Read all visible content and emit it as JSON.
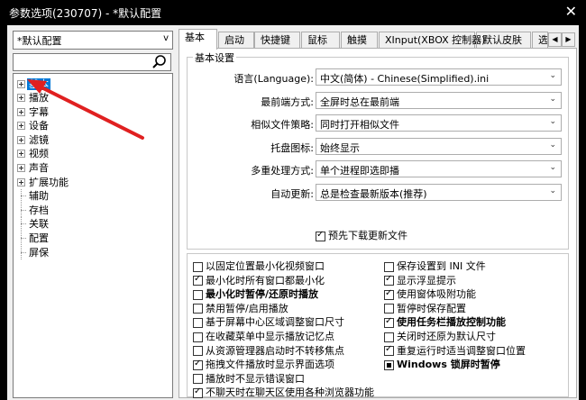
{
  "window": {
    "title": "参数选项(230707) - *默认配置",
    "close_label": "✕"
  },
  "sidebar": {
    "preset": "*默认配置",
    "search_value": "",
    "tree": [
      {
        "label": "基本",
        "expandable": true,
        "selected": true
      },
      {
        "label": "播放",
        "expandable": true
      },
      {
        "label": "字幕",
        "expandable": true
      },
      {
        "label": "设备",
        "expandable": true
      },
      {
        "label": "滤镜",
        "expandable": true
      },
      {
        "label": "视频",
        "expandable": true
      },
      {
        "label": "声音",
        "expandable": true
      },
      {
        "label": "扩展功能",
        "expandable": true
      },
      {
        "label": "辅助",
        "expandable": false
      },
      {
        "label": "存档",
        "expandable": false
      },
      {
        "label": "关联",
        "expandable": false
      },
      {
        "label": "配置",
        "expandable": false
      },
      {
        "label": "屏保",
        "expandable": false
      }
    ]
  },
  "tabs": [
    "基本",
    "启动",
    "快捷键",
    "鼠标",
    "触摸",
    "XInput(XBOX 控制器)",
    "默认皮肤",
    "选"
  ],
  "basic": {
    "group_title": "基本设置",
    "rows": [
      {
        "label": "语言(Language):",
        "value": "中文(简体) - Chinese(Simplified).ini"
      },
      {
        "label": "最前端方式:",
        "value": "全屏时总在最前端"
      },
      {
        "label": "相似文件策略:",
        "value": "同时打开相似文件"
      },
      {
        "label": "托盘图标:",
        "value": "始终显示"
      },
      {
        "label": "多重处理方式:",
        "value": "单个进程即选即播"
      },
      {
        "label": "自动更新:",
        "value": "总是检查最新版本(推荐)"
      }
    ],
    "predownload": {
      "label": "预先下载更新文件",
      "checked": true
    }
  },
  "options": {
    "left": [
      {
        "label": "以固定位置最小化视频窗口",
        "checked": false,
        "bold": false
      },
      {
        "label": "最小化时所有窗口都最小化",
        "checked": true,
        "bold": false
      },
      {
        "label": "最小化时暂停/还原时播放",
        "checked": false,
        "bold": true
      },
      {
        "label": "禁用暂停/启用播放",
        "checked": false,
        "bold": false
      },
      {
        "label": "基于屏幕中心区域调整窗口尺寸",
        "checked": false,
        "bold": false
      },
      {
        "label": "在收藏菜单中显示播放记忆点",
        "checked": false,
        "bold": false
      },
      {
        "label": "从资源管理器启动时不转移焦点",
        "checked": false,
        "bold": false
      },
      {
        "label": "拖拽文件播放时显示界面选项",
        "checked": true,
        "bold": false
      },
      {
        "label": "播放时不显示错误窗口",
        "checked": false,
        "bold": false
      },
      {
        "label": "不聊天时在聊天区使用各种浏览器功能",
        "checked": true,
        "bold": false
      }
    ],
    "right": [
      {
        "label": "保存设置到 INI 文件",
        "checked": false,
        "bold": false,
        "filled": false
      },
      {
        "label": "显示浮显提示",
        "checked": true,
        "bold": false,
        "filled": false
      },
      {
        "label": "使用窗体吸附功能",
        "checked": true,
        "bold": false,
        "filled": false
      },
      {
        "label": "暂停时保存配置",
        "checked": false,
        "bold": false,
        "filled": false
      },
      {
        "label": "使用任务栏播放控制功能",
        "checked": true,
        "bold": true,
        "filled": false
      },
      {
        "label": "关闭时还原为默认尺寸",
        "checked": false,
        "bold": false,
        "filled": false
      },
      {
        "label": "重复运行时适当调整窗口位置",
        "checked": true,
        "bold": false,
        "filled": false
      },
      {
        "label": "Windows 锁屏时暂停",
        "checked": false,
        "bold": true,
        "filled": true
      }
    ]
  },
  "colors": {
    "selection": "#0078d7",
    "annotation_arrow": "#e02020",
    "titlebar": "#000000"
  }
}
